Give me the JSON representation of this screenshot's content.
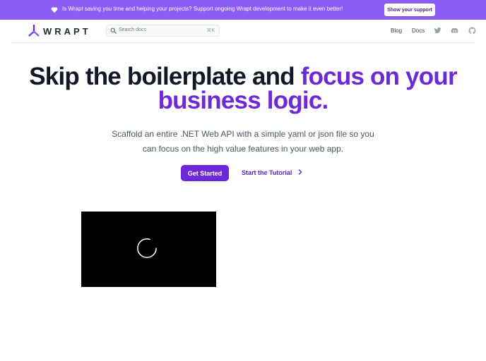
{
  "banner": {
    "message": "Is Wrapt saving you time and helping your projects? Support ongoing Wrapt development to make it even better!",
    "support_button": "Show your support",
    "icon": "heart-icon"
  },
  "header": {
    "brand": "WRAPT",
    "search": {
      "placeholder": "Search docs",
      "shortcut": "⌘K"
    },
    "nav": {
      "blog": "Blog",
      "docs": "Docs"
    },
    "icons": [
      "twitter-icon",
      "discord-icon",
      "github-icon"
    ]
  },
  "hero": {
    "title_part1": "Skip the boilerplate and ",
    "title_accent": "focus on your business logic.",
    "subtitle": "Scaffold an entire .NET Web API with a simple yaml or json file so you can focus on the high value features in your web app.",
    "primary_cta": "Get Started",
    "secondary_cta": "Start the Tutorial",
    "secondary_icon": "chevron-right-icon"
  },
  "video": {
    "state": "loading",
    "icon": "loading-spinner-icon"
  },
  "colors": {
    "banner": "#8b5cf6",
    "accent": "#6d28d9",
    "heading": "#111827"
  }
}
